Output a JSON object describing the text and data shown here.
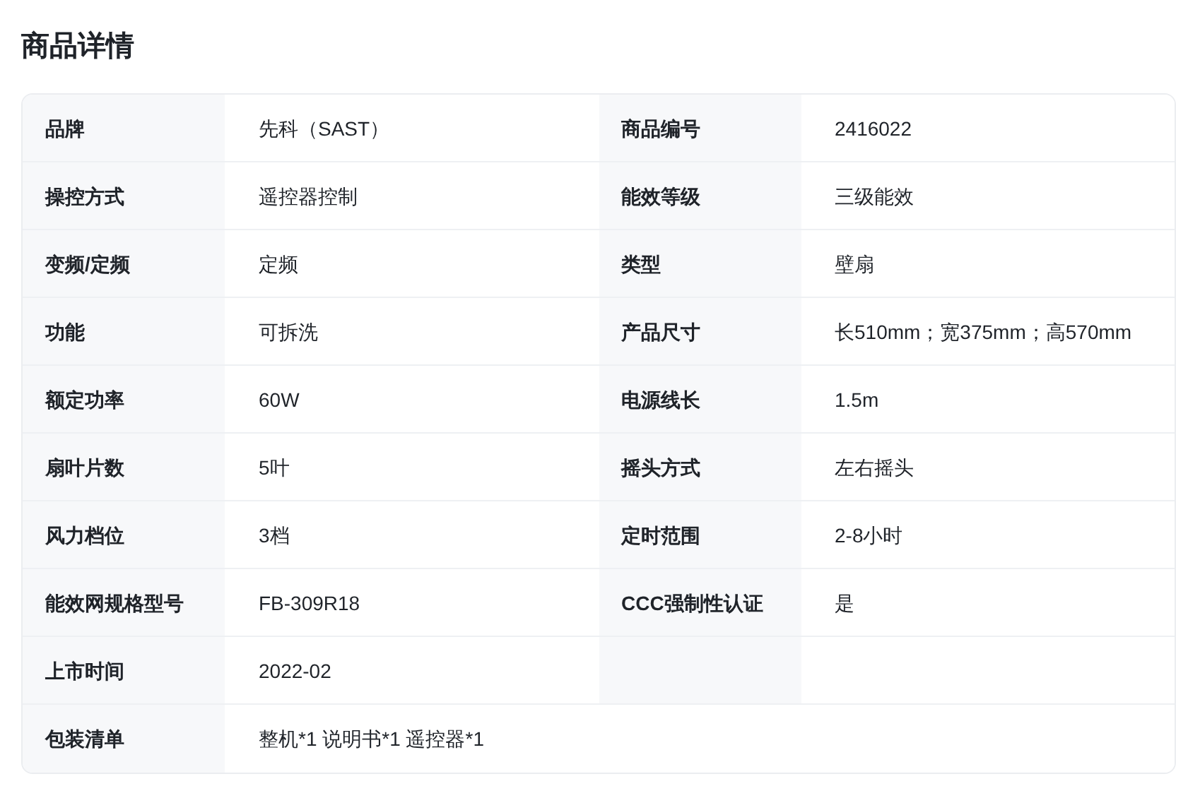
{
  "title": "商品详情",
  "rows": [
    {
      "kind": "pair",
      "items": [
        {
          "label": "品牌",
          "value": "先科（SAST）"
        },
        {
          "label": "商品编号",
          "value": "2416022"
        }
      ]
    },
    {
      "kind": "pair",
      "items": [
        {
          "label": "操控方式",
          "value": "遥控器控制"
        },
        {
          "label": "能效等级",
          "value": "三级能效"
        }
      ]
    },
    {
      "kind": "pair",
      "items": [
        {
          "label": "变频/定频",
          "value": "定频"
        },
        {
          "label": "类型",
          "value": "壁扇"
        }
      ]
    },
    {
      "kind": "pair",
      "items": [
        {
          "label": "功能",
          "value": "可拆洗"
        },
        {
          "label": "产品尺寸",
          "value": "长510mm；宽375mm；高570mm"
        }
      ]
    },
    {
      "kind": "pair",
      "items": [
        {
          "label": "额定功率",
          "value": "60W"
        },
        {
          "label": "电源线长",
          "value": "1.5m"
        }
      ]
    },
    {
      "kind": "pair",
      "items": [
        {
          "label": "扇叶片数",
          "value": "5叶"
        },
        {
          "label": "摇头方式",
          "value": "左右摇头"
        }
      ]
    },
    {
      "kind": "pair",
      "items": [
        {
          "label": "风力档位",
          "value": "3档"
        },
        {
          "label": "定时范围",
          "value": "2-8小时"
        }
      ]
    },
    {
      "kind": "pair",
      "items": [
        {
          "label": "能效网规格型号",
          "value": "FB-309R18"
        },
        {
          "label": "CCC强制性认证",
          "value": "是"
        }
      ]
    },
    {
      "kind": "pair",
      "items": [
        {
          "label": "上市时间",
          "value": "2022-02"
        }
      ]
    },
    {
      "kind": "wide",
      "items": [
        {
          "label": "包装清单",
          "value": "整机*1 说明书*1 遥控器*1"
        }
      ]
    }
  ]
}
